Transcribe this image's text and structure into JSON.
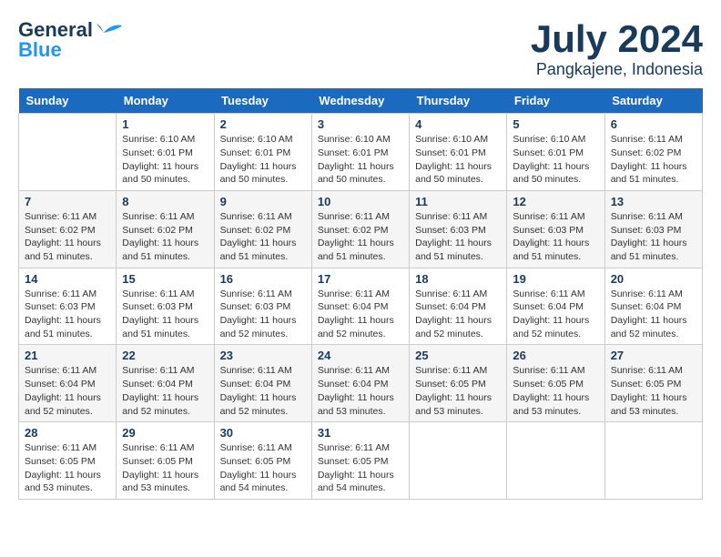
{
  "header": {
    "logo_line1": "General",
    "logo_line2": "Blue",
    "month": "July 2024",
    "location": "Pangkajene, Indonesia"
  },
  "weekdays": [
    "Sunday",
    "Monday",
    "Tuesday",
    "Wednesday",
    "Thursday",
    "Friday",
    "Saturday"
  ],
  "weeks": [
    [
      {
        "day": "",
        "info": ""
      },
      {
        "day": "1",
        "info": "Sunrise: 6:10 AM\nSunset: 6:01 PM\nDaylight: 11 hours\nand 50 minutes."
      },
      {
        "day": "2",
        "info": "Sunrise: 6:10 AM\nSunset: 6:01 PM\nDaylight: 11 hours\nand 50 minutes."
      },
      {
        "day": "3",
        "info": "Sunrise: 6:10 AM\nSunset: 6:01 PM\nDaylight: 11 hours\nand 50 minutes."
      },
      {
        "day": "4",
        "info": "Sunrise: 6:10 AM\nSunset: 6:01 PM\nDaylight: 11 hours\nand 50 minutes."
      },
      {
        "day": "5",
        "info": "Sunrise: 6:10 AM\nSunset: 6:01 PM\nDaylight: 11 hours\nand 50 minutes."
      },
      {
        "day": "6",
        "info": "Sunrise: 6:11 AM\nSunset: 6:02 PM\nDaylight: 11 hours\nand 51 minutes."
      }
    ],
    [
      {
        "day": "7",
        "info": "Sunrise: 6:11 AM\nSunset: 6:02 PM\nDaylight: 11 hours\nand 51 minutes."
      },
      {
        "day": "8",
        "info": "Sunrise: 6:11 AM\nSunset: 6:02 PM\nDaylight: 11 hours\nand 51 minutes."
      },
      {
        "day": "9",
        "info": "Sunrise: 6:11 AM\nSunset: 6:02 PM\nDaylight: 11 hours\nand 51 minutes."
      },
      {
        "day": "10",
        "info": "Sunrise: 6:11 AM\nSunset: 6:02 PM\nDaylight: 11 hours\nand 51 minutes."
      },
      {
        "day": "11",
        "info": "Sunrise: 6:11 AM\nSunset: 6:03 PM\nDaylight: 11 hours\nand 51 minutes."
      },
      {
        "day": "12",
        "info": "Sunrise: 6:11 AM\nSunset: 6:03 PM\nDaylight: 11 hours\nand 51 minutes."
      },
      {
        "day": "13",
        "info": "Sunrise: 6:11 AM\nSunset: 6:03 PM\nDaylight: 11 hours\nand 51 minutes."
      }
    ],
    [
      {
        "day": "14",
        "info": "Sunrise: 6:11 AM\nSunset: 6:03 PM\nDaylight: 11 hours\nand 51 minutes."
      },
      {
        "day": "15",
        "info": "Sunrise: 6:11 AM\nSunset: 6:03 PM\nDaylight: 11 hours\nand 51 minutes."
      },
      {
        "day": "16",
        "info": "Sunrise: 6:11 AM\nSunset: 6:03 PM\nDaylight: 11 hours\nand 52 minutes."
      },
      {
        "day": "17",
        "info": "Sunrise: 6:11 AM\nSunset: 6:04 PM\nDaylight: 11 hours\nand 52 minutes."
      },
      {
        "day": "18",
        "info": "Sunrise: 6:11 AM\nSunset: 6:04 PM\nDaylight: 11 hours\nand 52 minutes."
      },
      {
        "day": "19",
        "info": "Sunrise: 6:11 AM\nSunset: 6:04 PM\nDaylight: 11 hours\nand 52 minutes."
      },
      {
        "day": "20",
        "info": "Sunrise: 6:11 AM\nSunset: 6:04 PM\nDaylight: 11 hours\nand 52 minutes."
      }
    ],
    [
      {
        "day": "21",
        "info": "Sunrise: 6:11 AM\nSunset: 6:04 PM\nDaylight: 11 hours\nand 52 minutes."
      },
      {
        "day": "22",
        "info": "Sunrise: 6:11 AM\nSunset: 6:04 PM\nDaylight: 11 hours\nand 52 minutes."
      },
      {
        "day": "23",
        "info": "Sunrise: 6:11 AM\nSunset: 6:04 PM\nDaylight: 11 hours\nand 52 minutes."
      },
      {
        "day": "24",
        "info": "Sunrise: 6:11 AM\nSunset: 6:04 PM\nDaylight: 11 hours\nand 53 minutes."
      },
      {
        "day": "25",
        "info": "Sunrise: 6:11 AM\nSunset: 6:05 PM\nDaylight: 11 hours\nand 53 minutes."
      },
      {
        "day": "26",
        "info": "Sunrise: 6:11 AM\nSunset: 6:05 PM\nDaylight: 11 hours\nand 53 minutes."
      },
      {
        "day": "27",
        "info": "Sunrise: 6:11 AM\nSunset: 6:05 PM\nDaylight: 11 hours\nand 53 minutes."
      }
    ],
    [
      {
        "day": "28",
        "info": "Sunrise: 6:11 AM\nSunset: 6:05 PM\nDaylight: 11 hours\nand 53 minutes."
      },
      {
        "day": "29",
        "info": "Sunrise: 6:11 AM\nSunset: 6:05 PM\nDaylight: 11 hours\nand 53 minutes."
      },
      {
        "day": "30",
        "info": "Sunrise: 6:11 AM\nSunset: 6:05 PM\nDaylight: 11 hours\nand 54 minutes."
      },
      {
        "day": "31",
        "info": "Sunrise: 6:11 AM\nSunset: 6:05 PM\nDaylight: 11 hours\nand 54 minutes."
      },
      {
        "day": "",
        "info": ""
      },
      {
        "day": "",
        "info": ""
      },
      {
        "day": "",
        "info": ""
      }
    ]
  ]
}
